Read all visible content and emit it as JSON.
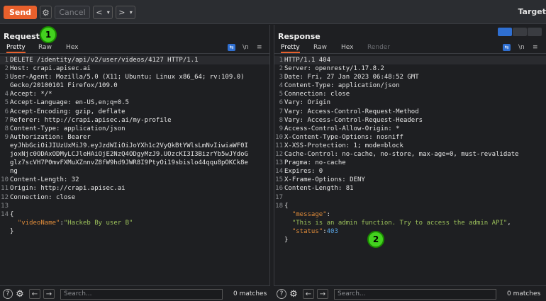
{
  "toolbar": {
    "send_label": "Send",
    "cancel_label": "Cancel",
    "back_label": "<",
    "back_dropdown": "▾",
    "forward_label": ">",
    "forward_dropdown": "▾",
    "target_label": "Target"
  },
  "request": {
    "title": "Request",
    "tabs": [
      "Pretty",
      "Raw",
      "Hex"
    ],
    "newline_icon": "\\n",
    "menu_icon": "≡",
    "lines": [
      {
        "n": "1",
        "text": "DELETE /identity/api/v2/user/videos/4127 HTTP/1.1"
      },
      {
        "n": "2",
        "text": "Host: crapi.apisec.ai"
      },
      {
        "n": "3",
        "text": "User-Agent: Mozilla/5.0 (X11; Ubuntu; Linux x86_64; rv:109.0)"
      },
      {
        "n": "",
        "text": "Gecko/20100101 Firefox/109.0"
      },
      {
        "n": "4",
        "text": "Accept: */*"
      },
      {
        "n": "5",
        "text": "Accept-Language: en-US,en;q=0.5"
      },
      {
        "n": "6",
        "text": "Accept-Encoding: gzip, deflate"
      },
      {
        "n": "7",
        "text": "Referer: http://crapi.apisec.ai/my-profile"
      },
      {
        "n": "8",
        "text": "Content-Type: application/json"
      },
      {
        "n": "9",
        "text": "Authorization: Bearer"
      },
      {
        "n": "",
        "text": "eyJhbGciOiJIUzUxMiJ9.eyJzdWIiOiJoYXh1c2VyQkBtYWlsLmNvIiwiaWF0I"
      },
      {
        "n": "",
        "text": "joxNjc0ODAxODMyLCJleHAiOjE2NzQ4ODgyMzJ9.UOzcKI3I3BizrYb5wJYdoG"
      },
      {
        "n": "",
        "text": "glz7scVH7P0mvFXMuXZnnvZ8fW9hd9JWR8I9PtyOi19sbislo44qqu8pOKCk8e"
      },
      {
        "n": "",
        "text": "ng"
      },
      {
        "n": "10",
        "text": "Content-Length: 32"
      },
      {
        "n": "11",
        "text": "Origin: http://crapi.apisec.ai"
      },
      {
        "n": "12",
        "text": "Connection: close"
      },
      {
        "n": "13",
        "text": ""
      },
      {
        "n": "14",
        "text": "{"
      },
      {
        "n": "",
        "text": ""
      },
      {
        "n": "",
        "text": "}"
      }
    ],
    "json_key": "\"videoName\"",
    "json_colon": ":",
    "json_value": "\"Hackeb By user B\""
  },
  "response": {
    "title": "Response",
    "tabs": [
      "Pretty",
      "Raw",
      "Hex",
      "Render"
    ],
    "newline_icon": "\\n",
    "menu_icon": "≡",
    "lines": [
      {
        "n": "1",
        "text": "HTTP/1.1 404"
      },
      {
        "n": "2",
        "text": "Server: openresty/1.17.8.2"
      },
      {
        "n": "3",
        "text": "Date: Fri, 27 Jan 2023 06:48:52 GMT"
      },
      {
        "n": "4",
        "text": "Content-Type: application/json"
      },
      {
        "n": "5",
        "text": "Connection: close"
      },
      {
        "n": "6",
        "text": "Vary: Origin"
      },
      {
        "n": "7",
        "text": "Vary: Access-Control-Request-Method"
      },
      {
        "n": "8",
        "text": "Vary: Access-Control-Request-Headers"
      },
      {
        "n": "9",
        "text": "Access-Control-Allow-Origin: *"
      },
      {
        "n": "10",
        "text": "X-Content-Type-Options: nosniff"
      },
      {
        "n": "11",
        "text": "X-XSS-Protection: 1; mode=block"
      },
      {
        "n": "12",
        "text": "Cache-Control: no-cache, no-store, max-age=0, must-revalidate"
      },
      {
        "n": "13",
        "text": "Pragma: no-cache"
      },
      {
        "n": "14",
        "text": "Expires: 0"
      },
      {
        "n": "15",
        "text": "X-Frame-Options: DENY"
      },
      {
        "n": "16",
        "text": "Content-Length: 81"
      },
      {
        "n": "17",
        "text": ""
      },
      {
        "n": "18",
        "text": "{"
      }
    ],
    "json_key1": "\"message\"",
    "json_colon1": ":",
    "json_val1": "\"This is an admin function. Try to access the admin API\"",
    "json_comma1": ",",
    "json_key2": "\"status\"",
    "json_colon2": ":",
    "json_val2": "403",
    "json_close": "}"
  },
  "footer": {
    "help_icon": "?",
    "search_placeholder": "Search...",
    "matches": "0 matches"
  },
  "annotations": {
    "badge1": "1",
    "badge2": "2"
  },
  "colors": {
    "accent": "#e8602c",
    "badge": "#43d11f",
    "json_key": "#e08c3a",
    "json_string": "#9cc15b",
    "json_number": "#5aa6e6"
  }
}
